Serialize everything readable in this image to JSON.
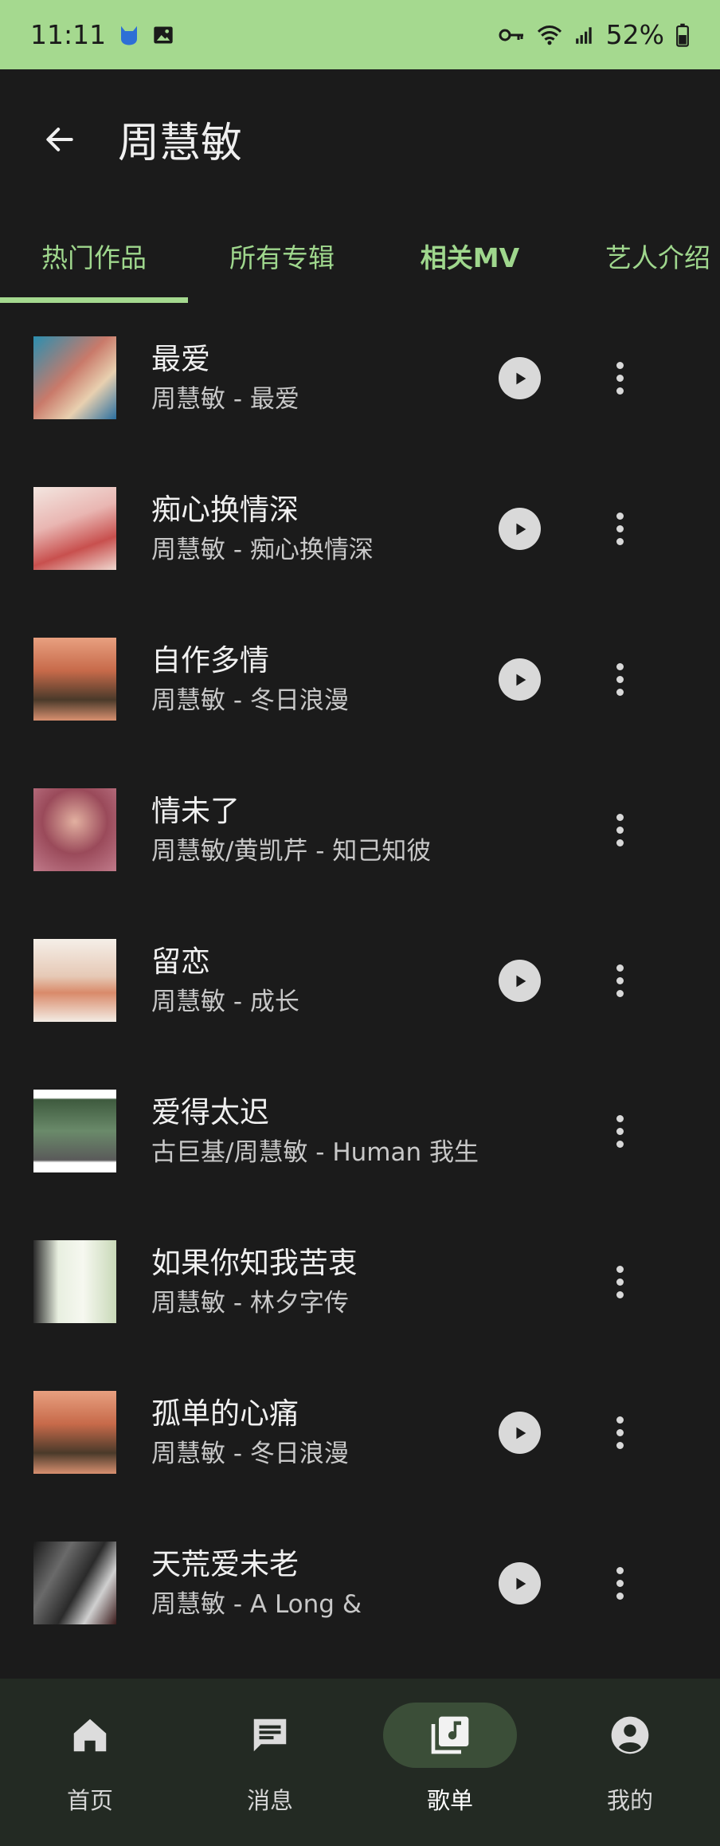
{
  "status_bar": {
    "time": "11:11",
    "battery": "52%",
    "icons": [
      "cat-icon",
      "image-icon",
      "key-icon",
      "wifi-icon",
      "signal-icon",
      "battery-icon"
    ]
  },
  "header": {
    "title": "周慧敏",
    "back_icon": "arrow-left-icon"
  },
  "tabs": [
    {
      "label": "热门作品",
      "active": true
    },
    {
      "label": "所有专辑",
      "active": false
    },
    {
      "label": "相关MV",
      "active": false
    },
    {
      "label": "艺人介绍",
      "active": false
    }
  ],
  "songs": [
    {
      "title": "最爱",
      "subtitle": "周慧敏 - 最爱",
      "playable": true
    },
    {
      "title": "痴心换情深",
      "subtitle": "周慧敏 - 痴心换情深",
      "playable": true
    },
    {
      "title": "自作多情",
      "subtitle": "周慧敏 - 冬日浪漫",
      "playable": true
    },
    {
      "title": "情未了",
      "subtitle": "周慧敏/黄凯芹 - 知己知彼",
      "playable": false
    },
    {
      "title": "留恋",
      "subtitle": "周慧敏 - 成长",
      "playable": true
    },
    {
      "title": "爱得太迟",
      "subtitle": "古巨基/周慧敏 - Human 我生",
      "playable": false
    },
    {
      "title": "如果你知我苦衷",
      "subtitle": "周慧敏 - 林夕字传",
      "playable": false
    },
    {
      "title": "孤单的心痛",
      "subtitle": "周慧敏 - 冬日浪漫",
      "playable": true
    },
    {
      "title": "天荒爱未老",
      "subtitle": "周慧敏 - A Long &",
      "playable": true
    }
  ],
  "bottom_nav": [
    {
      "label": "首页",
      "icon": "home-icon",
      "active": false
    },
    {
      "label": "消息",
      "icon": "message-icon",
      "active": false
    },
    {
      "label": "歌单",
      "icon": "music-library-icon",
      "active": true
    },
    {
      "label": "我的",
      "icon": "account-icon",
      "active": false
    }
  ],
  "colors": {
    "accent": "#a5d98f",
    "tab_text": "#9fd78d",
    "background": "#1b1b1b",
    "nav_background": "#232a23",
    "nav_active_pill": "#3b4e38"
  }
}
